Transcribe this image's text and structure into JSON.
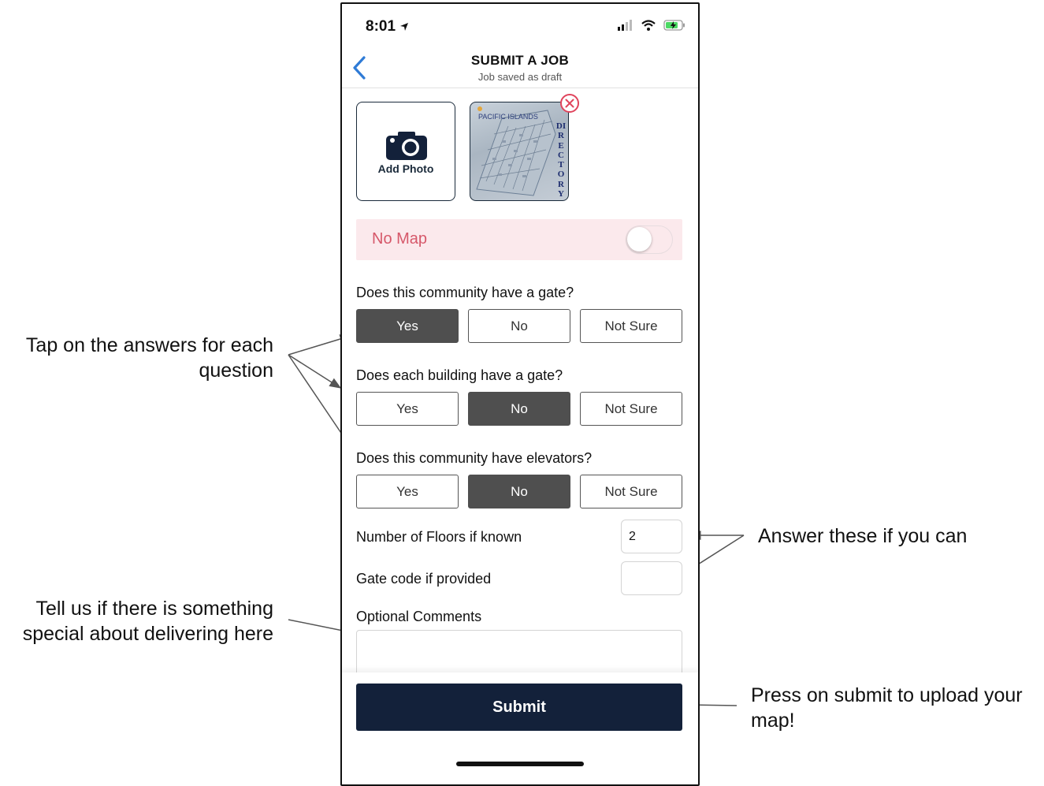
{
  "annotations": {
    "tap_answers": [
      "Tap on the answers for each",
      "question"
    ],
    "answer_if_can": "Answer these if you can",
    "tell_special": [
      "Tell us if there is something",
      "special about delivering here"
    ],
    "press_submit": [
      "Press on submit to upload your",
      "map!"
    ]
  },
  "status_bar": {
    "time": "8:01"
  },
  "header": {
    "title": "SUBMIT A JOB",
    "subtitle": "Job saved as draft"
  },
  "photos": {
    "add_label": "Add Photo",
    "thumbnail_text": {
      "brand": "PACIFIC ISLANDS",
      "vertical": "DIRECTORY"
    }
  },
  "no_map": {
    "label": "No Map",
    "toggle_on": false
  },
  "questions": [
    {
      "text": "Does this community have a gate?",
      "options": [
        "Yes",
        "No",
        "Not Sure"
      ],
      "selected": "Yes"
    },
    {
      "text": "Does each building have a gate?",
      "options": [
        "Yes",
        "No",
        "Not Sure"
      ],
      "selected": "No"
    },
    {
      "text": "Does this community have elevators?",
      "options": [
        "Yes",
        "No",
        "Not Sure"
      ],
      "selected": "No"
    }
  ],
  "fields": {
    "floors": {
      "label": "Number of Floors if known",
      "value": "2"
    },
    "gate_code": {
      "label": "Gate code if provided",
      "value": ""
    },
    "comments": {
      "label": "Optional Comments",
      "value": ""
    }
  },
  "submit": {
    "label": "Submit"
  },
  "colors": {
    "navy": "#13213a",
    "selected": "#4f4f4f",
    "nomap_bg": "#fbe9ec",
    "nomap_text": "#d6586a",
    "accent_blue": "#2f7bd6",
    "remove_red": "#e0445c"
  }
}
